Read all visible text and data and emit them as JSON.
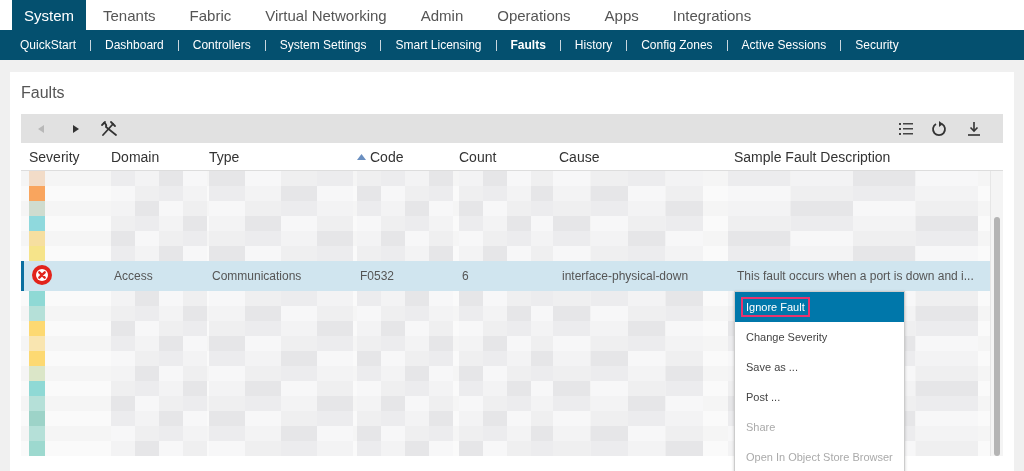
{
  "top_tabs": [
    {
      "label": "System",
      "selected": true
    },
    {
      "label": "Tenants",
      "selected": false
    },
    {
      "label": "Fabric",
      "selected": false
    },
    {
      "label": "Virtual Networking",
      "selected": false
    },
    {
      "label": "Admin",
      "selected": false
    },
    {
      "label": "Operations",
      "selected": false
    },
    {
      "label": "Apps",
      "selected": false
    },
    {
      "label": "Integrations",
      "selected": false
    }
  ],
  "sub_tabs": [
    {
      "label": "QuickStart",
      "selected": false
    },
    {
      "label": "Dashboard",
      "selected": false
    },
    {
      "label": "Controllers",
      "selected": false
    },
    {
      "label": "System Settings",
      "selected": false
    },
    {
      "label": "Smart Licensing",
      "selected": false
    },
    {
      "label": "Faults",
      "selected": true
    },
    {
      "label": "History",
      "selected": false
    },
    {
      "label": "Config Zones",
      "selected": false
    },
    {
      "label": "Active Sessions",
      "selected": false
    },
    {
      "label": "Security",
      "selected": false
    }
  ],
  "panel": {
    "title": "Faults"
  },
  "table": {
    "columns": [
      {
        "label": "Severity",
        "sorted": false
      },
      {
        "label": "Domain",
        "sorted": false
      },
      {
        "label": "Type",
        "sorted": false
      },
      {
        "label": "Code",
        "sorted": true
      },
      {
        "label": "Count",
        "sorted": false
      },
      {
        "label": "Cause",
        "sorted": false
      },
      {
        "label": "Sample Fault Description",
        "sorted": false
      }
    ],
    "rows": [
      {
        "kind": "redacted",
        "color": "#f2dcc8",
        "selected": false
      },
      {
        "kind": "redacted",
        "color": "#f9a55e",
        "selected": false
      },
      {
        "kind": "redacted",
        "color": "#cfdccf",
        "selected": false
      },
      {
        "kind": "redacted",
        "color": "#8fd9dd",
        "selected": false
      },
      {
        "kind": "redacted",
        "color": "#f6dfa0",
        "selected": false
      },
      {
        "kind": "redacted",
        "color": "#f6e48a",
        "selected": false
      },
      {
        "kind": "fault",
        "color": "#e2231a",
        "selected": true,
        "domain": "Access",
        "type": "Communications",
        "code": "F0532",
        "count": "6",
        "cause": "interface-physical-down",
        "description": "This fault occurs when a port is down and i..."
      },
      {
        "kind": "redacted",
        "color": "#8fd9d5",
        "selected": false
      },
      {
        "kind": "redacted",
        "color": "#b5e0d8",
        "selected": false
      },
      {
        "kind": "redacted",
        "color": "#fdd972",
        "selected": false
      },
      {
        "kind": "redacted",
        "color": "#f9e5b0",
        "selected": false
      },
      {
        "kind": "redacted",
        "color": "#fdd972",
        "selected": false
      },
      {
        "kind": "redacted",
        "color": "#dbe6c8",
        "selected": false
      },
      {
        "kind": "redacted",
        "color": "#8fd9d5",
        "selected": false
      },
      {
        "kind": "redacted",
        "color": "#b5e0d8",
        "selected": false
      },
      {
        "kind": "redacted",
        "color": "#9dd3c8",
        "selected": false
      },
      {
        "kind": "redacted",
        "color": "#b5e0d8",
        "selected": false
      },
      {
        "kind": "redacted",
        "color": "#9dd9cf",
        "selected": false
      }
    ]
  },
  "context_menu": [
    {
      "label": "Ignore Fault",
      "selected": true,
      "disabled": false
    },
    {
      "label": "Change Severity",
      "selected": false,
      "disabled": false
    },
    {
      "label": "Save as ...",
      "selected": false,
      "disabled": false
    },
    {
      "label": "Post ...",
      "selected": false,
      "disabled": false
    },
    {
      "label": "Share",
      "selected": false,
      "disabled": true
    },
    {
      "label": "Open In Object Store Browser",
      "selected": false,
      "disabled": true
    }
  ]
}
